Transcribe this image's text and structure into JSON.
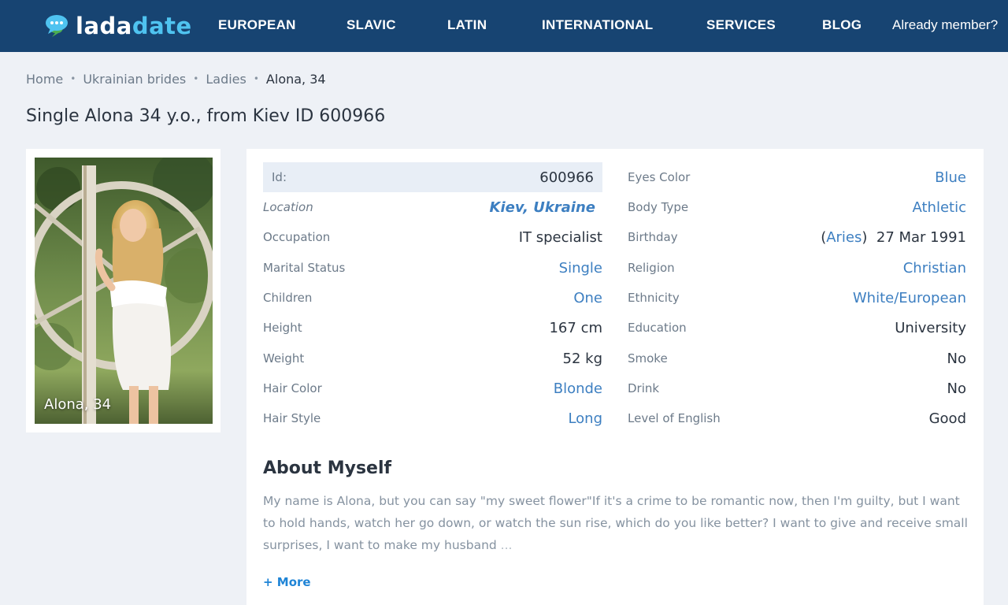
{
  "brand": {
    "name_part1": "lada",
    "name_part2": "date",
    "icon": "chat-bubbles-icon",
    "accent": "#4fc3f0",
    "header_bg": "#174472"
  },
  "nav": {
    "items": [
      {
        "label": "EUROPEAN"
      },
      {
        "label": "SLAVIC"
      },
      {
        "label": "LATIN"
      },
      {
        "label": "INTERNATIONAL"
      },
      {
        "label": "SERVICES"
      },
      {
        "label": "BLOG"
      }
    ],
    "member_link": "Already member?"
  },
  "breadcrumb": {
    "items": [
      "Home",
      "Ukrainian brides",
      "Ladies"
    ],
    "current": "Alona, 34",
    "separator": "•"
  },
  "page_title": "Single Alona 34 y.o., from Kiev ID 600966",
  "photo": {
    "caption": "Alona, 34"
  },
  "profile": {
    "left": [
      {
        "label": "Id:",
        "value": "600966"
      },
      {
        "label": "Location",
        "value": "Kiev, Ukraine"
      },
      {
        "label": "Occupation",
        "value": "IT specialist"
      },
      {
        "label": "Marital Status",
        "value": "Single"
      },
      {
        "label": "Children",
        "value": "One"
      },
      {
        "label": "Height",
        "value": "167 cm"
      },
      {
        "label": "Weight",
        "value": "52 kg"
      },
      {
        "label": "Hair Color",
        "value": "Blonde"
      },
      {
        "label": "Hair Style",
        "value": "Long"
      }
    ],
    "right": [
      {
        "label": "Eyes Color",
        "value": "Blue"
      },
      {
        "label": "Body Type",
        "value": "Athletic"
      },
      {
        "label": "Birthday",
        "zodiac": "Aries",
        "value": "27 Mar 1991"
      },
      {
        "label": "Religion",
        "value": "Christian"
      },
      {
        "label": "Ethnicity",
        "value": "White/European"
      },
      {
        "label": "Education",
        "value": "University"
      },
      {
        "label": "Smoke",
        "value": "No"
      },
      {
        "label": "Drink",
        "value": "No"
      },
      {
        "label": "Level of English",
        "value": "Good"
      }
    ]
  },
  "about": {
    "title": "About Myself",
    "text": "My name is Alona, but you can say \"my sweet flower\"If it's a crime to be romantic now, then I'm guilty, but I want to hold hands, watch her go down, or watch the sun rise, which do you like better? I want to give and receive small surprises, I want to make my husband",
    "ellipsis": "...",
    "more_label": "+ More"
  }
}
